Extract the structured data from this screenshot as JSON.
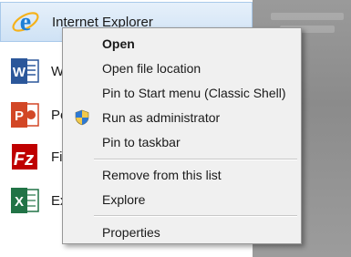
{
  "program_list": {
    "items": [
      {
        "label": "Internet Explorer",
        "icon": "internet-explorer-icon"
      },
      {
        "label": "W",
        "icon": "word-icon"
      },
      {
        "label": "Po",
        "icon": "powerpoint-icon"
      },
      {
        "label": "Fil",
        "icon": "filezilla-icon"
      },
      {
        "label": "Ex",
        "icon": "excel-icon"
      }
    ]
  },
  "context_menu": {
    "items": [
      {
        "label": "Open"
      },
      {
        "label": "Open file location"
      },
      {
        "label": "Pin to Start menu (Classic Shell)"
      },
      {
        "label": "Run as administrator",
        "icon": "uac-shield-icon"
      },
      {
        "label": "Pin to taskbar"
      },
      {
        "label": "Remove from this list"
      },
      {
        "label": "Explore"
      },
      {
        "label": "Properties"
      }
    ]
  },
  "colors": {
    "highlight": "#cfe2f5",
    "menu_bg": "#f0f0f0",
    "ie_blue": "#1e7fd6",
    "word_blue": "#2b579a",
    "powerpoint_orange": "#d24726",
    "filezilla_red": "#bf0000",
    "excel_green": "#217346"
  }
}
